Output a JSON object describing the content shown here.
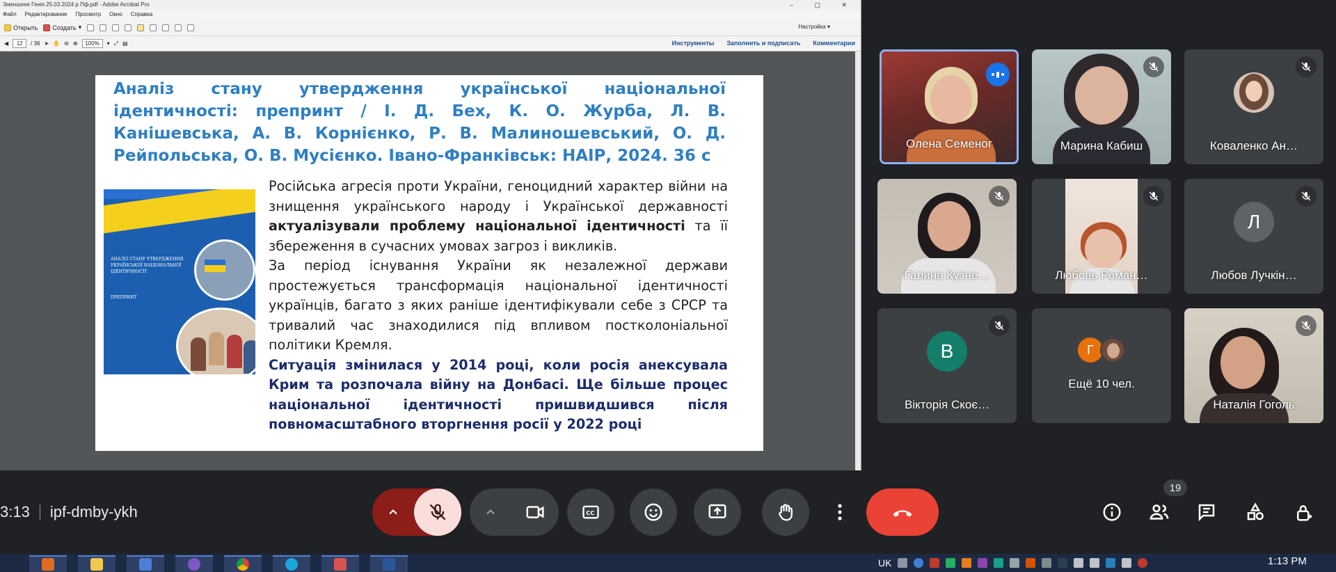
{
  "acrobat": {
    "window_title": "Зменшене Генія 25.03.2024 р Пф.pdf - Adobe Acrobat Pro",
    "menu": [
      "Файл",
      "Редактирование",
      "Просмотр",
      "Окно",
      "Справка"
    ],
    "open_label": "Открыть",
    "create_label": "Создать",
    "page_current": "12",
    "page_total": "/ 36",
    "zoom": "100%",
    "customize_label": "Настройка",
    "panel_links": [
      "Инструменты",
      "Заполнить и подписать",
      "Комментарии"
    ]
  },
  "slide": {
    "heading": "Аналіз стану утвердження української національної ідентичності: препринт / І. Д. Бех, К. О. Журба, Л. В. Канішевська, А. В. Корнієнко, Р. В. Малиношевський, О. Д. Рейпольська, О. В. Мусієнко. Івано-Франківськ: НАІР, 2024. 36 с",
    "p1_a": "Російська агресія проти України, геноцидний характер війни на знищення українського народу і Української державності ",
    "p1_bold": "актуалізували проблему національної ідентичності",
    "p1_b": " та її збереження в сучасних умовах загроз і викликів.",
    "p2": "За період існування України як незалежної держави простежується трансформація національної ідентичності українців, багато з яких раніше ідентифікували себе з СРСР та тривалий час знаходилися під впливом постколоніальної політики Кремля.",
    "p3": "Ситуація змінилася у 2014 році, коли росія анексувала Крим та розпочала війну на Донбасі. Ще більше процес національної ідентичності пришвидшився після повномасштабного вторгнення росії у 2022 році",
    "cover_title": "АНАЛІЗ СТАНУ УТВЕРДЖЕННЯ УКРАЇНСЬКОЇ НАЦІОНАЛЬНОЇ ІДЕНТИЧНОСТІ",
    "cover_sub": "ПРЕПРИНТ"
  },
  "participants": [
    {
      "name": "Олена Семеног",
      "type": "video",
      "speaking": true
    },
    {
      "name": "Марина Кабиш",
      "type": "video",
      "muted": true
    },
    {
      "name": "Коваленко Ан…",
      "type": "photo",
      "muted": true
    },
    {
      "name": "Галина Кузне…",
      "type": "video",
      "muted": true
    },
    {
      "name": "Любовь Роман…",
      "type": "video",
      "muted": true
    },
    {
      "name": "Любов Лучкін…",
      "type": "avatar",
      "initial": "Л",
      "color": "#5f6368",
      "muted": true
    },
    {
      "name": "Вікторія Скоє…",
      "type": "avatar",
      "initial": "В",
      "color": "#137e6a",
      "muted": true
    },
    {
      "name": "Ещё 10 чел.",
      "type": "more",
      "initial": "Г",
      "color": "#e8710a"
    },
    {
      "name": "Наталія Гоголь",
      "type": "video",
      "muted": true
    }
  ],
  "meeting": {
    "time": "3:13",
    "code": "ipf-dmby-ykh",
    "people_count": "19"
  },
  "taskbar": {
    "lang": "UK",
    "clock": "1:13 PM"
  },
  "colors": {
    "meet_bg": "#202124",
    "hangup": "#ea4335",
    "mic_off_bg": "#f9dedc",
    "speaking_ring": "#8ab4f8",
    "heading_blue": "#2f7fc2"
  }
}
